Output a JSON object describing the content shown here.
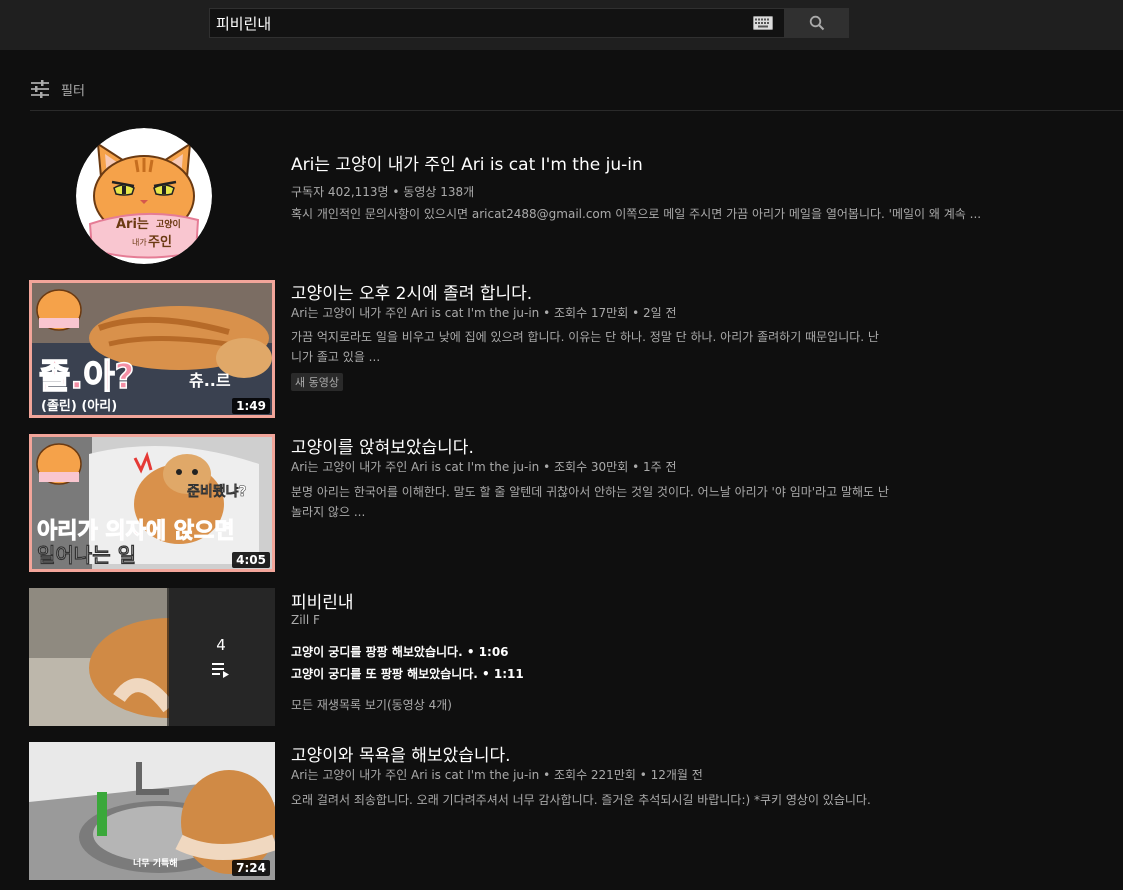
{
  "search": {
    "query": "피비린내",
    "keyboard_icon": "keyboard-icon",
    "search_icon": "search-icon"
  },
  "filter": {
    "label": "필터",
    "icon": "sliders-icon"
  },
  "channel": {
    "title": "Ari는 고양이 내가 주인 Ari is cat I'm the ju-in",
    "stats": "구독자 402,113명 • 동영상 138개",
    "description": "혹시 개인적인 문의사항이 있으시면 aricat2488@gmail.com 이쪽으로 메일 주시면 가끔 아리가 메일을 열어봅니다. '메일이 왜 계속 ...",
    "avatar_text_1": "Ari는",
    "avatar_text_2": "고양이",
    "avatar_text_3": "내가",
    "avatar_text_4": "주인"
  },
  "videos": [
    {
      "title": "고양이는 오후 2시에 졸려 합니다.",
      "meta": "Ari는 고양이 내가 주인 Ari is cat I'm the ju-in • 조회수 17만회 • 2일 전",
      "description": "가끔 억지로라도 일을 비우고 낮에 집에 있으려 합니다. 이유는 단 하나. 정말 단 하나. 아리가 졸려하기 때문입니다. 난 니가 졸고 있을 ...",
      "badge": "새 동영상",
      "duration": "1:49",
      "thumb_caption_1": "졸.아?",
      "thumb_caption_2": "(졸린) (아리)",
      "thumb_caption_3": "츄..르"
    },
    {
      "title": "고양이를 앉혀보았습니다.",
      "meta": "Ari는 고양이 내가 주인 Ari is cat I'm the ju-in • 조회수 30만회 • 1주 전",
      "description": "분명 아리는 한국어를 이해한다. 말도 할 줄 알텐데 귀찮아서 안하는 것일 것이다. 어느날 아리가 '야 임마'라고 말해도 난 놀라지 않으 ...",
      "duration": "4:05",
      "thumb_caption_1": "아리가 의자에 앉으면",
      "thumb_caption_2": "일어나는 일",
      "thumb_caption_3": "준비됐냐?"
    },
    {
      "title": "고양이와 목욕을 해보았습니다.",
      "meta": "Ari는 고양이 내가 주인 Ari is cat I'm the ju-in • 조회수 221만회 • 12개월 전",
      "description": "오래 걸려서 죄송합니다. 오래 기다려주셔서 너무 감사합니다. 즐거운 추석되시길 바랍니다:) *쿠키 영상이 있습니다.",
      "duration": "7:24",
      "thumb_caption_1": "너무 기특해"
    }
  ],
  "playlist": {
    "title": "피비린내",
    "channel": "Zill F",
    "count": "4",
    "items": [
      "고양이 궁디를 팡팡 해보았습니다. • 1:06",
      "고양이 궁디를 또 팡팡 해보았습니다. • 1:11"
    ],
    "view_all": "모든 재생목록 보기(동영상 4개)",
    "icon": "playlist-icon"
  },
  "colors": {
    "background": "#0f0f0f",
    "masthead": "#1f1f1f",
    "accent_pink": "#f4a9a0",
    "text_secondary": "#aaaaaa"
  }
}
